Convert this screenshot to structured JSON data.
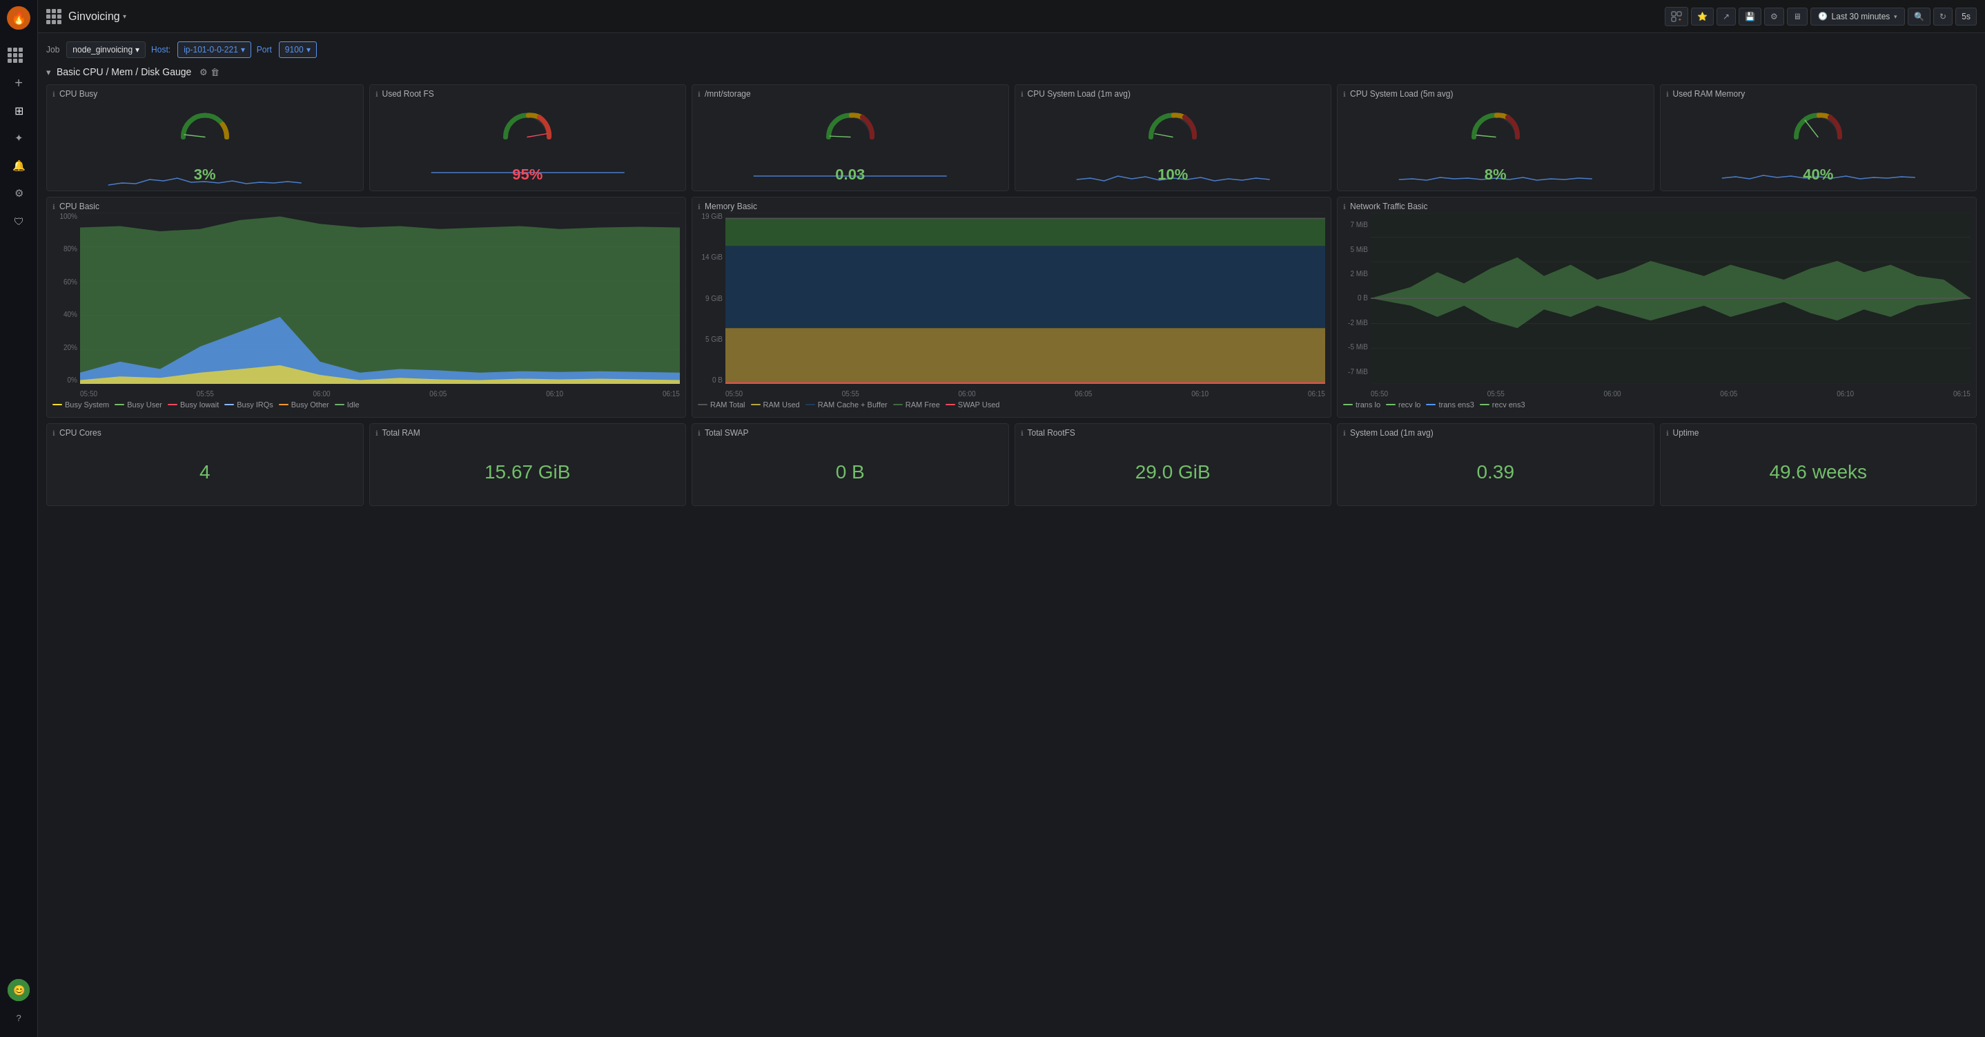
{
  "app": {
    "name": "Ginvoicing",
    "logo_icon": "🔥"
  },
  "navbar": {
    "time_range": "Last 30 minutes",
    "refresh_interval": "5s",
    "actions": [
      "bar-chart-icon",
      "star-icon",
      "share-icon",
      "save-icon",
      "settings-icon",
      "monitor-icon"
    ]
  },
  "filters": [
    {
      "label": "Job",
      "value": "node_ginvoicing"
    },
    {
      "label": "Host:",
      "value": "ip-101-0-0-221"
    },
    {
      "label": "Port",
      "value": "9100"
    }
  ],
  "section": {
    "title": "Basic CPU / Mem / Disk Gauge",
    "collapsed": false
  },
  "gauges": [
    {
      "title": "CPU Busy",
      "value": "3%",
      "color": "#73bf69",
      "percent": 3,
      "arc_color_sequence": [
        "green",
        "yellow",
        "red"
      ]
    },
    {
      "title": "Used Root FS",
      "value": "95%",
      "color": "#f2495c",
      "percent": 95,
      "arc_color_sequence": [
        "green",
        "yellow",
        "red"
      ]
    },
    {
      "title": "/mnt/storage",
      "value": "0.03",
      "color": "#73bf69",
      "percent": 3,
      "arc_color_sequence": [
        "green",
        "yellow",
        "red"
      ]
    },
    {
      "title": "CPU System Load (1m avg)",
      "value": "10%",
      "color": "#73bf69",
      "percent": 10,
      "arc_color_sequence": [
        "green",
        "yellow",
        "red"
      ]
    },
    {
      "title": "CPU System Load (5m avg)",
      "value": "8%",
      "color": "#73bf69",
      "percent": 8,
      "arc_color_sequence": [
        "green",
        "yellow",
        "red"
      ]
    },
    {
      "title": "Used RAM Memory",
      "value": "40%",
      "color": "#73bf69",
      "percent": 40,
      "arc_color_sequence": [
        "green",
        "yellow",
        "red"
      ]
    }
  ],
  "charts": [
    {
      "title": "CPU Basic",
      "y_labels": [
        "100%",
        "80%",
        "60%",
        "40%",
        "20%",
        "0%"
      ],
      "x_labels": [
        "05:50",
        "05:55",
        "06:00",
        "06:05",
        "06:10",
        "06:15"
      ],
      "legend": [
        {
          "label": "Busy System",
          "color": "#fade2a"
        },
        {
          "label": "Busy User",
          "color": "#73bf69"
        },
        {
          "label": "Busy Iowait",
          "color": "#f2495c"
        },
        {
          "label": "Busy IRQs",
          "color": "#8ab8ff"
        },
        {
          "label": "Busy Other",
          "color": "#ff9830"
        },
        {
          "label": "Idle",
          "color": "#6eb26e"
        }
      ],
      "type": "cpu"
    },
    {
      "title": "Memory Basic",
      "y_labels": [
        "19 GiB",
        "14 GiB",
        "9 GiB",
        "5 GiB",
        "0 B"
      ],
      "x_labels": [
        "05:50",
        "05:55",
        "06:00",
        "06:05",
        "06:10",
        "06:15"
      ],
      "legend": [
        {
          "label": "RAM Total",
          "color": "#222"
        },
        {
          "label": "RAM Used",
          "color": "#b5a642"
        },
        {
          "label": "RAM Cache + Buffer",
          "color": "#1f3d5c"
        },
        {
          "label": "RAM Free",
          "color": "#3d6b3d"
        },
        {
          "label": "SWAP Used",
          "color": "#f2495c"
        }
      ],
      "type": "memory"
    },
    {
      "title": "Network Traffic Basic",
      "y_labels": [
        "7 MiB",
        "5 MiB",
        "2 MiB",
        "0 B",
        "-2 MiB",
        "-5 MiB",
        "-7 MiB"
      ],
      "x_labels": [
        "05:50",
        "05:55",
        "06:00",
        "06:05",
        "06:10",
        "06:15"
      ],
      "legend": [
        {
          "label": "trans lo",
          "color": "#73bf69"
        },
        {
          "label": "recv lo",
          "color": "#73bf69"
        },
        {
          "label": "trans ens3",
          "color": "#5794f2"
        },
        {
          "label": "recv ens3",
          "color": "#73bf69"
        }
      ],
      "type": "network"
    }
  ],
  "stats": [
    {
      "title": "CPU Cores",
      "value": "4",
      "color": "#73bf69"
    },
    {
      "title": "Total RAM",
      "value": "15.67 GiB",
      "color": "#73bf69"
    },
    {
      "title": "Total SWAP",
      "value": "0 B",
      "color": "#73bf69"
    },
    {
      "title": "Total RootFS",
      "value": "29.0 GiB",
      "color": "#73bf69"
    },
    {
      "title": "System Load (1m avg)",
      "value": "0.39",
      "color": "#73bf69"
    },
    {
      "title": "Uptime",
      "value": "49.6 weeks",
      "color": "#73bf69"
    }
  ],
  "sidebar": {
    "items": [
      {
        "icon": "+",
        "name": "add"
      },
      {
        "icon": "⊞",
        "name": "dashboard"
      },
      {
        "icon": "✦",
        "name": "explore"
      },
      {
        "icon": "🔔",
        "name": "alerts"
      },
      {
        "icon": "⚙",
        "name": "settings"
      },
      {
        "icon": "🛡",
        "name": "shield"
      }
    ]
  }
}
